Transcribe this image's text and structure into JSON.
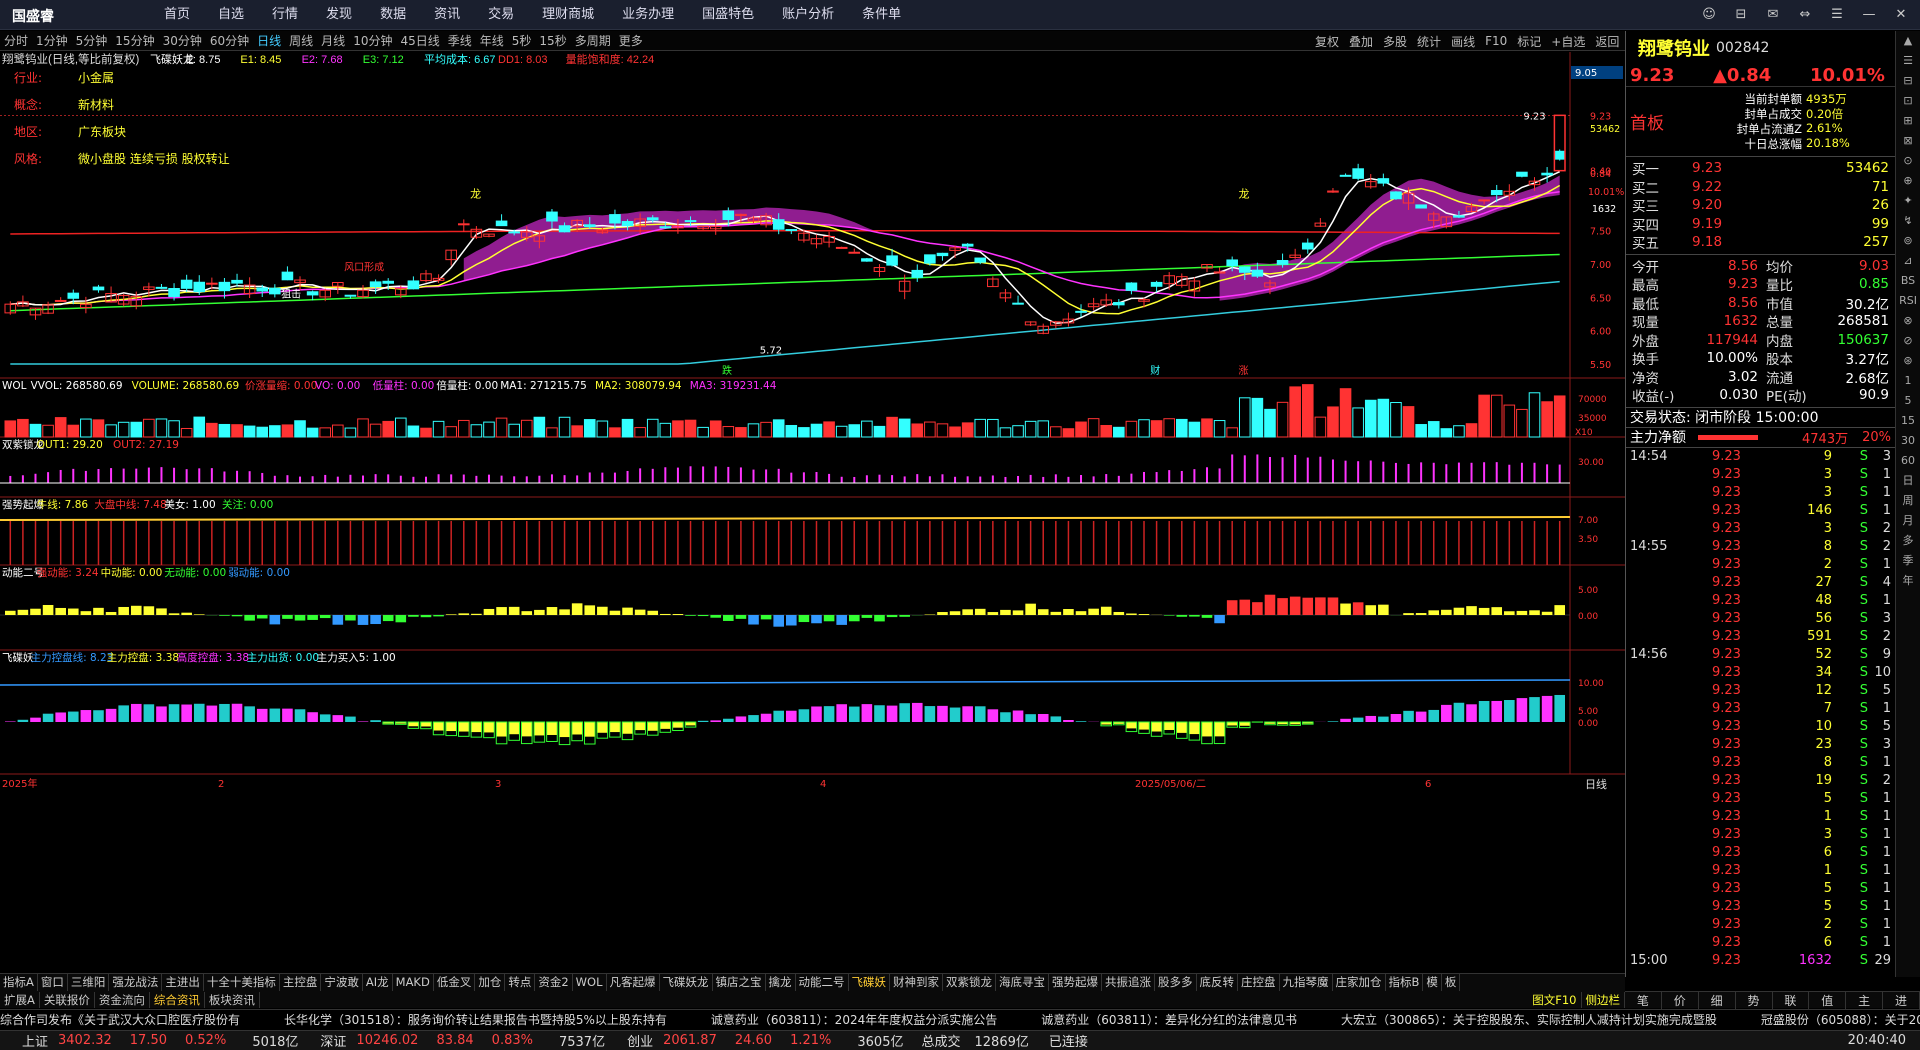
{
  "app": {
    "logo": "国盛睿"
  },
  "topnav": [
    "首页",
    "自选",
    "行情",
    "发现",
    "数据",
    "资讯",
    "交易",
    "理财商城",
    "业务办理",
    "国盛特色",
    "账户分析",
    "条件单"
  ],
  "winbtns": [
    "☺",
    "⊟",
    "✉",
    "⇔",
    "☰",
    "—",
    "✕"
  ],
  "periods": [
    "分时",
    "1分钟",
    "5分钟",
    "15分钟",
    "30分钟",
    "60分钟",
    "日线",
    "周线",
    "月线",
    "10分钟",
    "45日线",
    "季线",
    "年线",
    "5秒",
    "15秒",
    "多周期",
    "更多"
  ],
  "active_period": "日线",
  "right_tools": [
    "复权",
    "叠加",
    "多股",
    "统计",
    "画线",
    "F10",
    "标记",
    "+自选",
    "返回"
  ],
  "main_header": {
    "title": "翔鹭钨业(日线,等比前复权)",
    "items": [
      {
        "t": "飞碟妖龙",
        "c": "#fff"
      },
      {
        "t": "E: 8.75",
        "c": "#fff"
      },
      {
        "t": "E1: 8.45",
        "c": "#ff3"
      },
      {
        "t": "E2: 7.68",
        "c": "#f3f"
      },
      {
        "t": "E3: 7.12",
        "c": "#3f3"
      },
      {
        "t": "平均成本: 6.67",
        "c": "#3ff"
      },
      {
        "t": "DD1: 8.03",
        "c": "#f33"
      },
      {
        "t": "量能饱和度: 42.24",
        "c": "#f33"
      }
    ]
  },
  "info_panel": [
    {
      "k": "行业:",
      "v": "小金属"
    },
    {
      "k": "概念:",
      "v": "新材料"
    },
    {
      "k": "地区:",
      "v": "广东板块"
    },
    {
      "k": "风格:",
      "v": "微小盘股 连续亏损 股权转让"
    }
  ],
  "price_axis": [
    "9.23",
    "8.40",
    "7.50",
    "7.00",
    "6.50",
    "6.00",
    "5.50"
  ],
  "axis_extra": {
    "hi_price": "9.05",
    "qty": "53462",
    "chg1": "0.84",
    "pct1": "10.01%",
    "vol1": "1632"
  },
  "annotations": {
    "hi": "9.23",
    "lo": "5.72",
    "long1": "龙",
    "long2": "龙",
    "zhuji": "狙击",
    "fengkou": "风口形成",
    "die": "跌",
    "cai": "财",
    "zhang": "涨"
  },
  "panels": [
    {
      "name": "WOL",
      "items": [
        {
          "t": "WOL",
          "c": "#fff"
        },
        {
          "t": "VVOL: 268580.69",
          "c": "#fff"
        },
        {
          "t": "VOLUME: 268580.69",
          "c": "#ff3"
        },
        {
          "t": "价涨量缩: 0.00",
          "c": "#f33"
        },
        {
          "t": "VO: 0.00",
          "c": "#f3f"
        },
        {
          "t": "低量柱: 0.00",
          "c": "#f3f"
        },
        {
          "t": "倍量柱: 0.00",
          "c": "#fff"
        },
        {
          "t": "MA1: 271215.75",
          "c": "#fff"
        },
        {
          "t": "MA2: 308079.94",
          "c": "#ff3"
        },
        {
          "t": "MA3: 319231.44",
          "c": "#f3f"
        }
      ],
      "axis": [
        "70000",
        "35000",
        "X10"
      ]
    },
    {
      "name": "双紫锁龙",
      "items": [
        {
          "t": "双紫锁龙",
          "c": "#fff"
        },
        {
          "t": "OUT1: 29.20",
          "c": "#ff3"
        },
        {
          "t": "OUT2: 27.19",
          "c": "#f33"
        }
      ],
      "axis": [
        "30.00"
      ]
    },
    {
      "name": "强势起爆",
      "items": [
        {
          "t": "强势起爆",
          "c": "#fff"
        },
        {
          "t": "牛线: 7.86",
          "c": "#ff3"
        },
        {
          "t": "大盘中线: 7.48",
          "c": "#f33"
        },
        {
          "t": "美女: 1.00",
          "c": "#fff"
        },
        {
          "t": "关注: 0.00",
          "c": "#3f3"
        }
      ],
      "axis": [
        "7.00",
        "3.50"
      ]
    },
    {
      "name": "动能二号",
      "items": [
        {
          "t": "动能二号",
          "c": "#fff"
        },
        {
          "t": "强动能: 3.24",
          "c": "#f33"
        },
        {
          "t": "中动能: 0.00",
          "c": "#ff3"
        },
        {
          "t": "无动能: 0.00",
          "c": "#3f3"
        },
        {
          "t": "弱动能: 0.00",
          "c": "#39f"
        }
      ],
      "axis": [
        "5.00",
        "0.00"
      ]
    },
    {
      "name": "飞碟妖",
      "items": [
        {
          "t": "飞碟妖",
          "c": "#fff"
        },
        {
          "t": "主力控盘线: 8.23",
          "c": "#39f"
        },
        {
          "t": "主力控盘: 3.38",
          "c": "#ff3"
        },
        {
          "t": "高度控盘: 3.38",
          "c": "#f3f"
        },
        {
          "t": "主力出货: 0.00",
          "c": "#3ff"
        },
        {
          "t": "主力买入5: 1.00",
          "c": "#fff"
        }
      ],
      "axis": [
        "10.00",
        "5.00",
        "0.00"
      ]
    }
  ],
  "date_axis": [
    "2025年",
    "2",
    "3",
    "4",
    "2025/05/06/二",
    "6"
  ],
  "date_axis_label": "日线",
  "ind_tabs": [
    "指标A",
    "窗口",
    "三维阳",
    "强龙战法",
    "主进出",
    "十全十美指标",
    "主控盘",
    "宁波敢",
    "AI龙",
    "MAKD",
    "低金叉",
    "加仓",
    "转点",
    "资金2",
    "WOL",
    "凡客起爆",
    "飞碟妖龙",
    "镇店之宝",
    "擒龙",
    "动能二号",
    "飞碟妖",
    "财神到家",
    "双紫锁龙",
    "海底寻宝",
    "强势起爆",
    "共振追涨",
    "股多多",
    "底反转",
    "庄控盘",
    "九指琴魔",
    "庄家加仓",
    "指标B",
    "模",
    "板"
  ],
  "active_ind": "飞碟妖",
  "bot_tabs": [
    "扩展A",
    "关联报价",
    "资金流向",
    "综合资讯",
    "板块资讯"
  ],
  "active_bot": "综合资讯",
  "bot_right": [
    "图文F10",
    "侧边栏"
  ],
  "news": [
    "综合作司发布《关于武汉大众口腔医疗股份有",
    "长华化学（301518）：服务询价转让结果报告书暨持股5%以上股东持有",
    "诚意药业（603811）：2024年年度权益分派实施公告",
    "诚意药业（603811）：差异化分红的法律意见书",
    "大宏立（300865）：关于控股股东、实际控制人减持计划实施完成暨股",
    "冠盛股份（605088）：关于2024年"
  ],
  "status": [
    {
      "n": "上证",
      "p": "3402.32",
      "c": "17.50",
      "pc": "0.52%",
      "a": "5018亿"
    },
    {
      "n": "深证",
      "p": "10246.02",
      "c": "83.84",
      "pc": "0.83%",
      "a": "7537亿"
    },
    {
      "n": "创业",
      "p": "2061.87",
      "c": "24.60",
      "pc": "1.21%",
      "a": "3605亿"
    }
  ],
  "status_total": {
    "label": "总成交",
    "amt": "12869亿",
    "conn": "已连接",
    "time": "20:40:40"
  },
  "stock": {
    "name": "翔鹭钨业",
    "code": "002842",
    "price": "9.23",
    "chg": "▲0.84",
    "pct": "10.01%",
    "badge": "首板"
  },
  "seal": [
    {
      "k": "当前封单额",
      "v": "4935万"
    },
    {
      "k": "封单占成交",
      "v": "0.20倍"
    },
    {
      "k": "封单占流通Z",
      "v": "2.61%"
    },
    {
      "k": "十日总涨幅",
      "v": "20.18%"
    }
  ],
  "bids": [
    {
      "k": "买一",
      "p": "9.23",
      "q": "53462"
    },
    {
      "k": "买二",
      "p": "9.22",
      "q": "71"
    },
    {
      "k": "买三",
      "p": "9.20",
      "q": "26"
    },
    {
      "k": "买四",
      "p": "9.19",
      "q": "99"
    },
    {
      "k": "买五",
      "p": "9.18",
      "q": "257"
    }
  ],
  "stats": [
    {
      "k1": "今开",
      "v1": "8.56",
      "k2": "均价",
      "v2": "9.03"
    },
    {
      "k1": "最高",
      "v1": "9.23",
      "k2": "量比",
      "v2": "0.85"
    },
    {
      "k1": "最低",
      "v1": "8.56",
      "k2": "市值",
      "v2": "30.2亿"
    },
    {
      "k1": "现量",
      "v1": "1632",
      "k2": "总量",
      "v2": "268581"
    },
    {
      "k1": "外盘",
      "v1": "117944",
      "k2": "内盘",
      "v2": "150637"
    },
    {
      "k1": "换手",
      "v1": "10.00%",
      "k2": "股本",
      "v2": "3.27亿"
    },
    {
      "k1": "净资",
      "v1": "3.02",
      "k2": "流通",
      "v2": "2.68亿"
    },
    {
      "k1": "收益(-)",
      "v1": "0.030",
      "k2": "PE(动)",
      "v2": "90.9"
    }
  ],
  "trade_state": "交易状态: 闭市阶段 15:00:00",
  "main_flow": {
    "k": "主力净额",
    "v": "4743万",
    "p": "20%"
  },
  "ticks": [
    {
      "t": "14:54",
      "p": "9.23",
      "v": "9",
      "s": "S",
      "n": "3"
    },
    {
      "t": "",
      "p": "9.23",
      "v": "3",
      "s": "S",
      "n": "1"
    },
    {
      "t": "",
      "p": "9.23",
      "v": "3",
      "s": "S",
      "n": "1"
    },
    {
      "t": "",
      "p": "9.23",
      "v": "146",
      "s": "S",
      "n": "1"
    },
    {
      "t": "",
      "p": "9.23",
      "v": "3",
      "s": "S",
      "n": "2"
    },
    {
      "t": "14:55",
      "p": "9.23",
      "v": "8",
      "s": "S",
      "n": "2"
    },
    {
      "t": "",
      "p": "9.23",
      "v": "2",
      "s": "S",
      "n": "1"
    },
    {
      "t": "",
      "p": "9.23",
      "v": "27",
      "s": "S",
      "n": "4"
    },
    {
      "t": "",
      "p": "9.23",
      "v": "48",
      "s": "S",
      "n": "1"
    },
    {
      "t": "",
      "p": "9.23",
      "v": "56",
      "s": "S",
      "n": "3"
    },
    {
      "t": "",
      "p": "9.23",
      "v": "591",
      "s": "S",
      "n": "2"
    },
    {
      "t": "14:56",
      "p": "9.23",
      "v": "52",
      "s": "S",
      "n": "9"
    },
    {
      "t": "",
      "p": "9.23",
      "v": "34",
      "s": "S",
      "n": "10"
    },
    {
      "t": "",
      "p": "9.23",
      "v": "12",
      "s": "S",
      "n": "5"
    },
    {
      "t": "",
      "p": "9.23",
      "v": "7",
      "s": "S",
      "n": "1"
    },
    {
      "t": "",
      "p": "9.23",
      "v": "10",
      "s": "S",
      "n": "5"
    },
    {
      "t": "",
      "p": "9.23",
      "v": "23",
      "s": "S",
      "n": "3"
    },
    {
      "t": "",
      "p": "9.23",
      "v": "8",
      "s": "S",
      "n": "1"
    },
    {
      "t": "",
      "p": "9.23",
      "v": "19",
      "s": "S",
      "n": "2"
    },
    {
      "t": "",
      "p": "9.23",
      "v": "5",
      "s": "S",
      "n": "1"
    },
    {
      "t": "",
      "p": "9.23",
      "v": "1",
      "s": "S",
      "n": "1"
    },
    {
      "t": "",
      "p": "9.23",
      "v": "3",
      "s": "S",
      "n": "1"
    },
    {
      "t": "",
      "p": "9.23",
      "v": "6",
      "s": "S",
      "n": "1"
    },
    {
      "t": "",
      "p": "9.23",
      "v": "1",
      "s": "S",
      "n": "1"
    },
    {
      "t": "",
      "p": "9.23",
      "v": "5",
      "s": "S",
      "n": "1"
    },
    {
      "t": "",
      "p": "9.23",
      "v": "5",
      "s": "S",
      "n": "1"
    },
    {
      "t": "",
      "p": "9.23",
      "v": "2",
      "s": "S",
      "n": "1"
    },
    {
      "t": "",
      "p": "9.23",
      "v": "6",
      "s": "S",
      "n": "1"
    },
    {
      "t": "15:00",
      "p": "9.23",
      "v": "1632",
      "s": "S",
      "n": "29"
    }
  ],
  "rp_bottom": [
    "笔",
    "价",
    "细",
    "势",
    "联",
    "值",
    "主",
    "进"
  ],
  "rsidebar": [
    "▲",
    "☰",
    "⊟",
    "⊡",
    "⊞",
    "⊠",
    "⊙",
    "⊕",
    "✦",
    "↯",
    "⊚",
    "⊿",
    "BS",
    "RSI",
    "⊗",
    "⊘",
    "⊛",
    "1",
    "5",
    "15",
    "30",
    "60",
    "日",
    "周",
    "月",
    "多",
    "季",
    "年"
  ],
  "colors": {
    "up": "#ff3333",
    "down": "#33ffff",
    "ma5": "#ffffff",
    "ma10": "#ffff33",
    "ma20": "#ff33ff",
    "ma60": "#33ff33",
    "ma120": "#33ccdd",
    "ma250": "#ee2222"
  }
}
